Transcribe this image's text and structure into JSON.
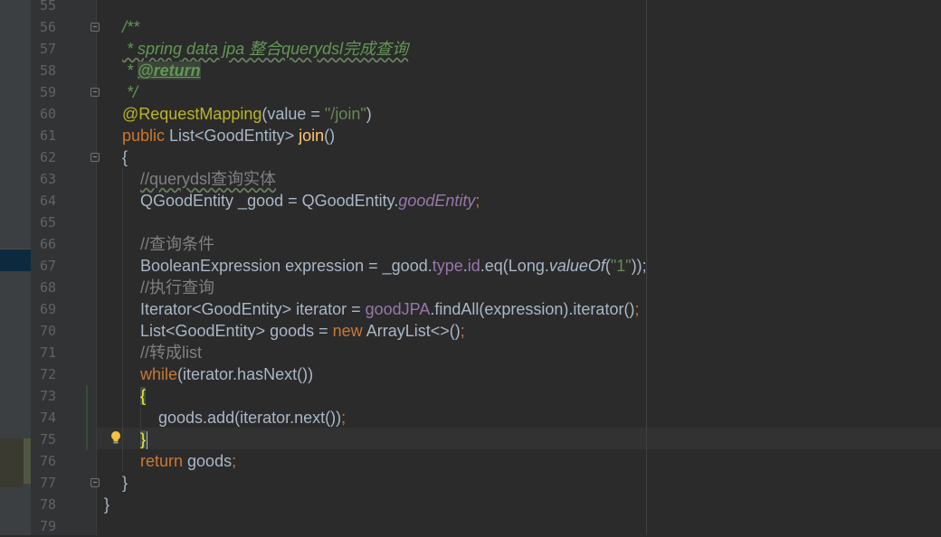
{
  "editor": {
    "colors": {
      "background": "#2b2b2b",
      "gutter": "#313335",
      "keyword": "#cc7832",
      "annotation": "#bbb529",
      "string": "#6a8759",
      "comment": "#808080",
      "doc_comment": "#629755",
      "field": "#9876aa",
      "default_text": "#a9b7c6"
    },
    "line_numbers": [
      "55",
      "56",
      "57",
      "58",
      "59",
      "60",
      "61",
      "62",
      "63",
      "64",
      "65",
      "66",
      "67",
      "68",
      "69",
      "70",
      "71",
      "72",
      "73",
      "74",
      "75",
      "76",
      "77",
      "78",
      "79"
    ],
    "code": {
      "l56_doc_open": "/**",
      "l57_doc_text": " * spring data jpa 整合querydsl完成查询",
      "l58_doc_star": " * ",
      "l58_doc_tag": "@return",
      "l59_doc_close": " */",
      "l60_annotation": "@RequestMapping",
      "l60_open": "(value = ",
      "l60_string": "\"/join\"",
      "l60_close": ")",
      "l61_public": "public",
      "l61_type": " List<GoodEntity> ",
      "l61_name": "join",
      "l61_parens": "()",
      "l62_brace": "{",
      "l63_comment": "//querydsl查询实体",
      "l64_lhs": "QGoodEntity _good = QGoodEntity.",
      "l64_static": "goodEntity",
      "l64_semi": ";",
      "l66_comment": "//查询条件",
      "l67_a": "BooleanExpression expression = _good.",
      "l67_type": "type",
      "l67_dot": ".",
      "l67_id": "id",
      "l67_b": ".eq(Long.",
      "l67_valueof": "valueOf",
      "l67_c": "(",
      "l67_str": "\"1\"",
      "l67_d": "));",
      "l68_comment": "//执行查询",
      "l69_a": "Iterator<GoodEntity> iterator = ",
      "l69_field": "goodJPA",
      "l69_b": ".findAll(expression).iterator()",
      "l69_semi": ";",
      "l70_a": "List<GoodEntity> goods = ",
      "l70_new": "new",
      "l70_b": " ArrayList<>()",
      "l70_semi": ";",
      "l71_comment": "//转成list",
      "l72_while": "while",
      "l72_rest": "(iterator.hasNext())",
      "l73_brace": "{",
      "l74_stmt": "goods.add(iterator.next())",
      "l74_semi": ";",
      "l75_brace": "}",
      "l76_return": "return",
      "l76_rest": " goods",
      "l76_semi": ";",
      "l77_brace": "}",
      "l78_brace": "}"
    },
    "icons": {
      "intention_bulb": "lightbulb-icon",
      "fold_marker": "fold-icon"
    }
  }
}
